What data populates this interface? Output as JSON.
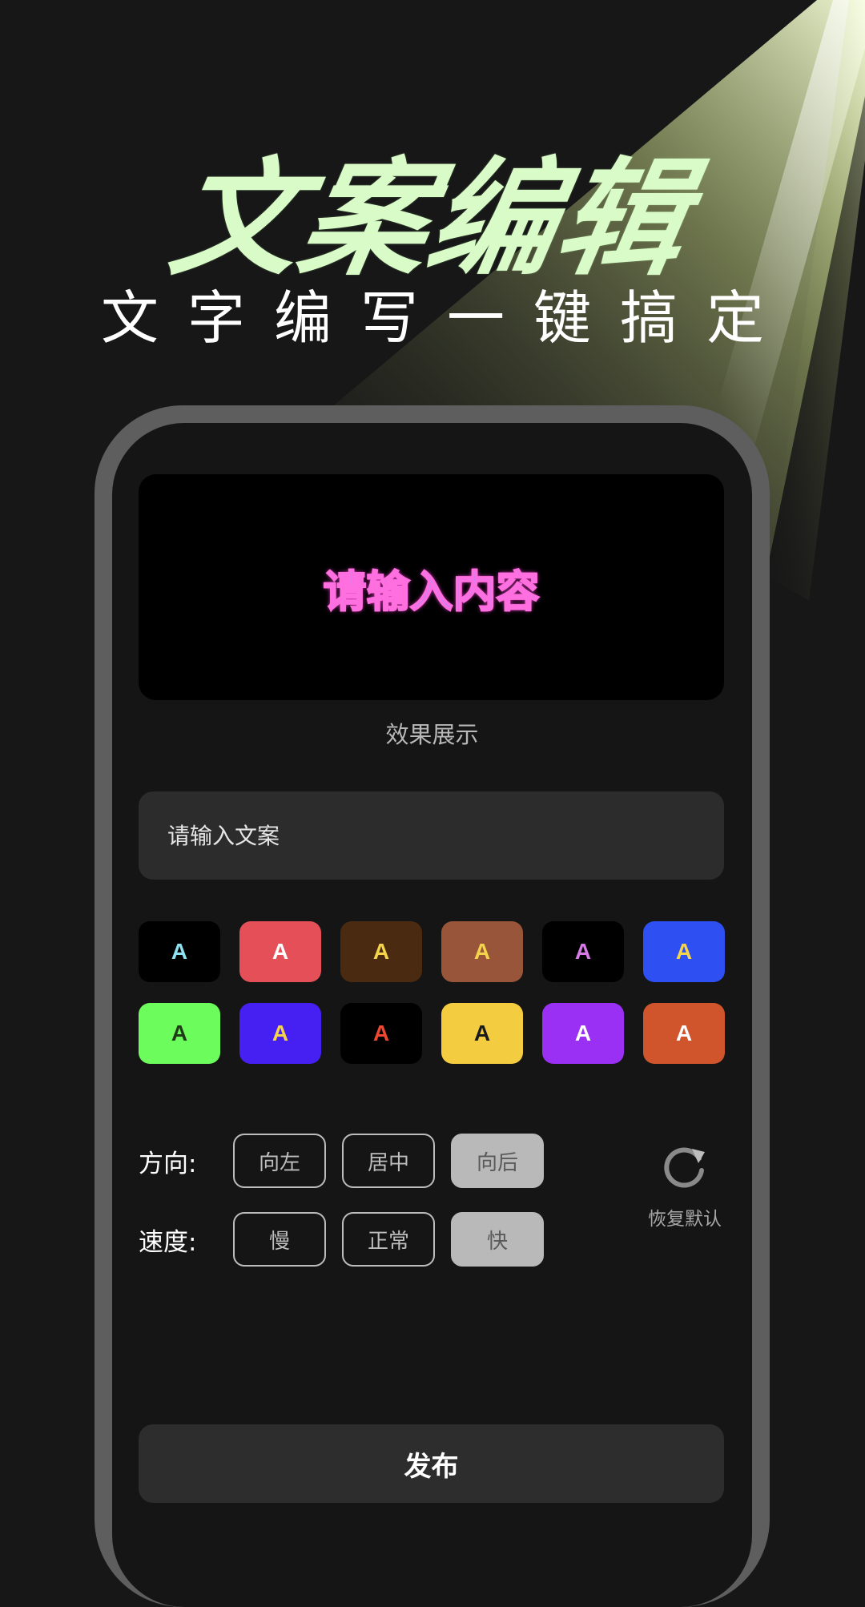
{
  "header": {
    "title": "文案编辑",
    "subtitle": "文字编写一键搞定"
  },
  "preview": {
    "sample_text": "请输入内容",
    "caption": "效果展示"
  },
  "input": {
    "placeholder": "请输入文案"
  },
  "swatches": [
    {
      "letter": "A",
      "bg": "#000000",
      "fg": "#8fe3f0"
    },
    {
      "letter": "A",
      "bg": "#e55058",
      "fg": "#ffffff"
    },
    {
      "letter": "A",
      "bg": "#4a2a10",
      "fg": "#f4d44a"
    },
    {
      "letter": "A",
      "bg": "#98553a",
      "fg": "#f4d44a"
    },
    {
      "letter": "A",
      "bg": "#000000",
      "fg": "#d67ae6"
    },
    {
      "letter": "A",
      "bg": "#2e50f2",
      "fg": "#f4d44a"
    },
    {
      "letter": "A",
      "bg": "#6cfc5c",
      "fg": "#1e3a16"
    },
    {
      "letter": "A",
      "bg": "#4620f2",
      "fg": "#f4d44a"
    },
    {
      "letter": "A",
      "bg": "#000000",
      "fg": "#f04830"
    },
    {
      "letter": "A",
      "bg": "#f4cc40",
      "fg": "#1a1a1a"
    },
    {
      "letter": "A",
      "bg": "#9a30f4",
      "fg": "#ffffff"
    },
    {
      "letter": "A",
      "bg": "#d0552c",
      "fg": "#ffffff"
    }
  ],
  "direction": {
    "label": "方向:",
    "options": [
      "向左",
      "居中",
      "向后"
    ],
    "selected": "向后"
  },
  "speed": {
    "label": "速度:",
    "options": [
      "慢",
      "正常",
      "快"
    ],
    "selected": "快"
  },
  "reset": {
    "label": "恢复默认",
    "icon": "refresh-icon"
  },
  "publish": {
    "label": "发布"
  },
  "colors": {
    "background": "#171717",
    "title_green": "#d9fbc8",
    "phone_frame": "#5e5e5e",
    "screen": "#151515"
  }
}
